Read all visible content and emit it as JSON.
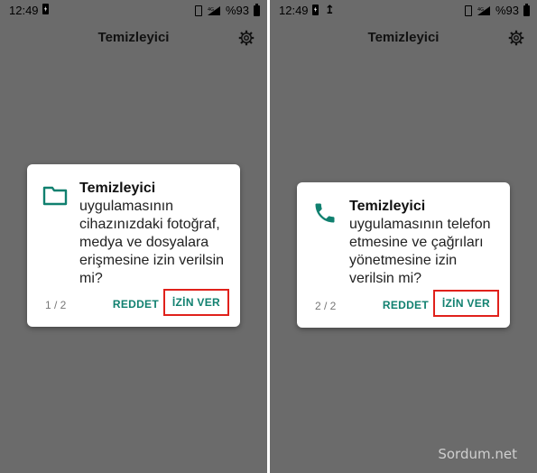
{
  "colors": {
    "accent": "#10806f",
    "highlight_box": "#e0211b",
    "scrim": "#6b6b6b"
  },
  "screens": [
    {
      "status": {
        "time": "12:49",
        "battery": "%93",
        "network": "4G"
      },
      "app_title": "Temizleyici",
      "dialog": {
        "icon": "folder-icon",
        "app_name": "Temizleyici",
        "message": "uygulamasının cihazınızdaki fotoğraf, medya ve dosyalara erişmesine izin verilsin mi?",
        "page": "1 / 2",
        "deny_label": "REDDET",
        "allow_label": "İZİN VER"
      }
    },
    {
      "status": {
        "time": "12:49",
        "battery": "%93",
        "network": "4G"
      },
      "app_title": "Temizleyici",
      "dialog": {
        "icon": "phone-icon",
        "app_name": "Temizleyici",
        "message": "uygulamasının telefon etmesine ve çağrıları yönetmesine izin verilsin mi?",
        "page": "2 / 2",
        "deny_label": "REDDET",
        "allow_label": "İZİN VER"
      }
    }
  ],
  "watermark": "Sordum.net"
}
